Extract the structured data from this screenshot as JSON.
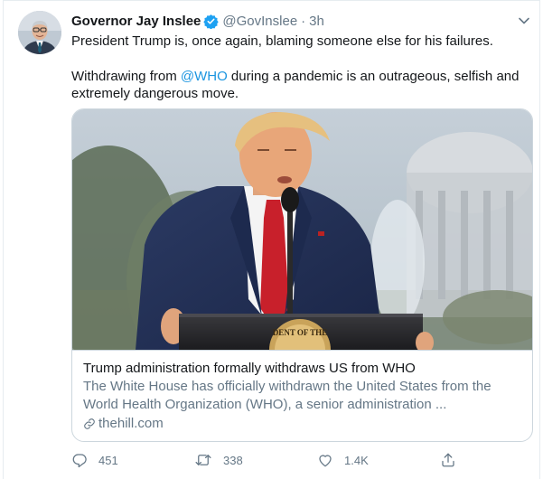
{
  "author": {
    "name": "Governor Jay Inslee",
    "handle": "@GovInslee",
    "separator": "·",
    "time": "3h"
  },
  "tweet": {
    "line1": "President Trump is, once again, blaming someone else for his failures.",
    "line2_before": "Withdrawing from ",
    "mention": "@WHO",
    "line2_after": " during a pandemic is an outrageous, selfish and extremely dangerous move."
  },
  "card": {
    "title": "Trump administration formally withdraws US from WHO",
    "description": "The White House has officially withdrawn the United States from the World Health Organization (WHO), a senior administration ...",
    "domain": "thehill.com",
    "seal_text": "DENT OF THE"
  },
  "actions": {
    "replies": "451",
    "retweets": "338",
    "likes": "1.4K"
  },
  "colors": {
    "link": "#1b95e0",
    "secondary": "#657786",
    "verified": "#1da1f2",
    "border": "#ccd6dd"
  },
  "icons": [
    "verified-badge-icon",
    "chevron-down-icon",
    "link-icon",
    "reply-icon",
    "retweet-icon",
    "like-icon",
    "share-icon"
  ]
}
